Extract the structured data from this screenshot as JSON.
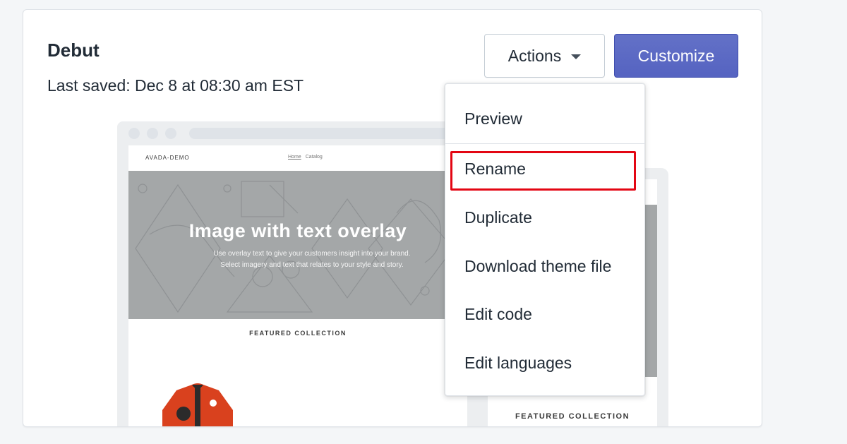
{
  "theme": {
    "name": "Debut",
    "last_saved": "Last saved: Dec 8 at 08:30 am EST"
  },
  "buttons": {
    "actions_label": "Actions",
    "customize_label": "Customize"
  },
  "preview": {
    "site_logo": "AVADA-DEMO",
    "nav_links": [
      "Home",
      "Catalog"
    ],
    "hero_title": "Image with text overlay",
    "hero_subtitle_line1": "Use overlay text to give your customers insight into your brand.",
    "hero_subtitle_line2": "Select imagery and text that relates to your style and story.",
    "featured_label": "FEATURED COLLECTION",
    "mobile_featured_label": "FEATURED COLLECTION"
  },
  "actions_menu": {
    "items": [
      {
        "label": "Preview"
      },
      {
        "label": "Rename",
        "highlighted": true
      },
      {
        "label": "Duplicate"
      },
      {
        "label": "Download theme file"
      },
      {
        "label": "Edit code"
      },
      {
        "label": "Edit languages"
      }
    ]
  },
  "colors": {
    "primary": "#5c6ac4",
    "highlight_border": "#e30613",
    "hero_gray": "#a4a7a8",
    "page_bg": "#f4f6f8"
  },
  "icons": {
    "actions_caret": "chevron-down-icon"
  }
}
